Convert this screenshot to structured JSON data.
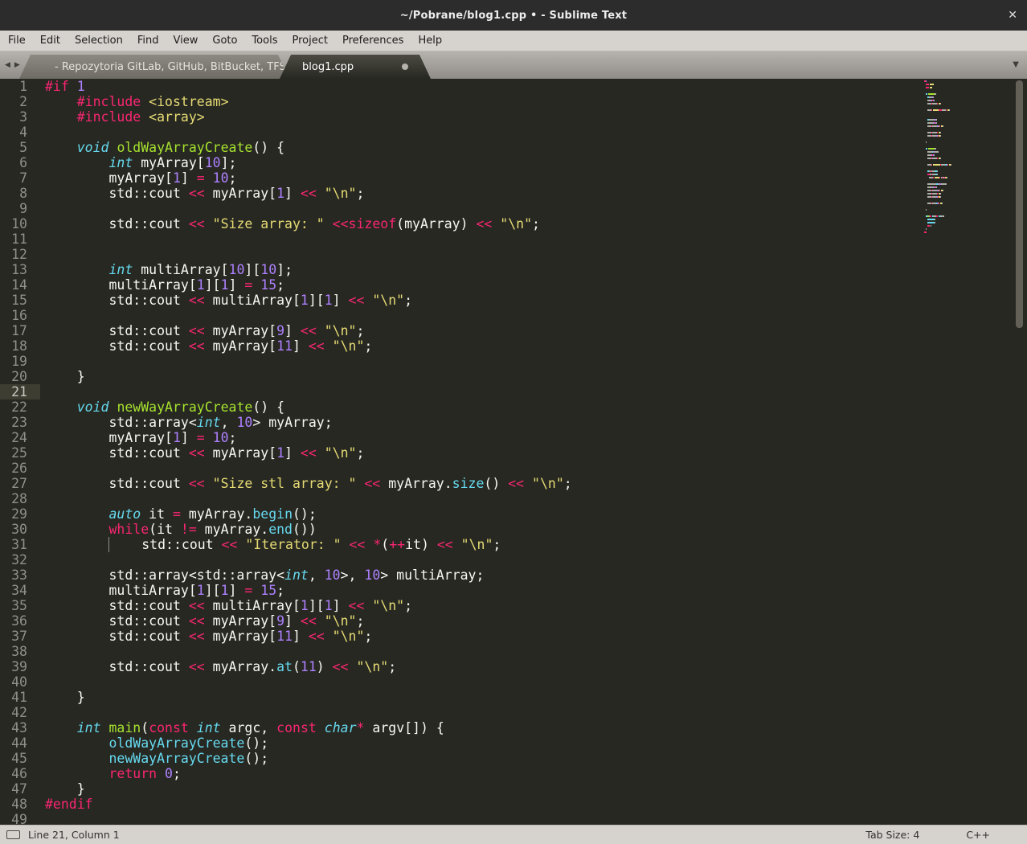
{
  "window": {
    "title": "~/Pobrane/blog1.cpp • - Sublime Text"
  },
  "icons": {
    "close": "✕",
    "back": "◀",
    "forward": "▶",
    "overflow": "▼"
  },
  "menu": {
    "items": [
      "File",
      "Edit",
      "Selection",
      "Find",
      "View",
      "Goto",
      "Tools",
      "Project",
      "Preferences",
      "Help"
    ]
  },
  "tabs": [
    {
      "label": "- Repozytoria GitLab, GitHub, BitBucket, TFS",
      "modified": true,
      "active": false
    },
    {
      "label": "blog1.cpp",
      "modified": true,
      "active": true
    }
  ],
  "status_bar": {
    "position": "Line 21, Column 1",
    "tab_size": "Tab Size: 4",
    "syntax": "C++"
  },
  "editor": {
    "current_line": 21,
    "total_lines": 49,
    "colors": {
      "background": "#272822",
      "foreground": "#f8f8f2",
      "keyword": "#f92672",
      "type": "#66d9ef",
      "call": "#66d9ef",
      "function": "#a6e22e",
      "string": "#e6db74",
      "number": "#ae81ff",
      "gutter": "#8f908a",
      "line_highlight": "#3e3d32"
    },
    "token_classes": {
      "k": "keyword",
      "t": "type-italic",
      "c": "function-call",
      "f": "function-definition",
      "s": "string",
      "n": "number",
      "p": "plain",
      "g": "indent-guide"
    },
    "lines": [
      {
        "i": 0,
        "t": [
          [
            "k",
            "#if"
          ],
          [
            "p",
            " "
          ],
          [
            "n",
            "1"
          ]
        ]
      },
      {
        "i": 4,
        "t": [
          [
            "k",
            "#include"
          ],
          [
            "p",
            " "
          ],
          [
            "s",
            "<iostream>"
          ]
        ]
      },
      {
        "i": 4,
        "t": [
          [
            "k",
            "#include"
          ],
          [
            "p",
            " "
          ],
          [
            "s",
            "<array>"
          ]
        ]
      },
      {
        "i": 0,
        "t": []
      },
      {
        "i": 4,
        "t": [
          [
            "t",
            "void"
          ],
          [
            "p",
            " "
          ],
          [
            "f",
            "oldWayArrayCreate"
          ],
          [
            "p",
            "() {"
          ]
        ]
      },
      {
        "i": 8,
        "t": [
          [
            "t",
            "int"
          ],
          [
            "p",
            " myArray["
          ],
          [
            "n",
            "10"
          ],
          [
            "p",
            "];"
          ]
        ]
      },
      {
        "i": 8,
        "t": [
          [
            "p",
            "myArray["
          ],
          [
            "n",
            "1"
          ],
          [
            "p",
            "] "
          ],
          [
            "k",
            "="
          ],
          [
            "p",
            " "
          ],
          [
            "n",
            "10"
          ],
          [
            "p",
            ";"
          ]
        ]
      },
      {
        "i": 8,
        "t": [
          [
            "p",
            "std::cout "
          ],
          [
            "k",
            "<<"
          ],
          [
            "p",
            " myArray["
          ],
          [
            "n",
            "1"
          ],
          [
            "p",
            "] "
          ],
          [
            "k",
            "<<"
          ],
          [
            "p",
            " "
          ],
          [
            "s",
            "\"\\n\""
          ],
          [
            "p",
            ";"
          ]
        ]
      },
      {
        "i": 0,
        "t": []
      },
      {
        "i": 8,
        "t": [
          [
            "p",
            "std::cout "
          ],
          [
            "k",
            "<<"
          ],
          [
            "p",
            " "
          ],
          [
            "s",
            "\"Size array: \""
          ],
          [
            "p",
            " "
          ],
          [
            "k",
            "<<sizeof"
          ],
          [
            "p",
            "(myArray) "
          ],
          [
            "k",
            "<<"
          ],
          [
            "p",
            " "
          ],
          [
            "s",
            "\"\\n\""
          ],
          [
            "p",
            ";"
          ]
        ]
      },
      {
        "i": 0,
        "t": []
      },
      {
        "i": 0,
        "t": []
      },
      {
        "i": 8,
        "t": [
          [
            "t",
            "int"
          ],
          [
            "p",
            " multiArray["
          ],
          [
            "n",
            "10"
          ],
          [
            "p",
            "]["
          ],
          [
            "n",
            "10"
          ],
          [
            "p",
            "];"
          ]
        ]
      },
      {
        "i": 8,
        "t": [
          [
            "p",
            "multiArray["
          ],
          [
            "n",
            "1"
          ],
          [
            "p",
            "]["
          ],
          [
            "n",
            "1"
          ],
          [
            "p",
            "] "
          ],
          [
            "k",
            "="
          ],
          [
            "p",
            " "
          ],
          [
            "n",
            "15"
          ],
          [
            "p",
            ";"
          ]
        ]
      },
      {
        "i": 8,
        "t": [
          [
            "p",
            "std::cout "
          ],
          [
            "k",
            "<<"
          ],
          [
            "p",
            " multiArray["
          ],
          [
            "n",
            "1"
          ],
          [
            "p",
            "]["
          ],
          [
            "n",
            "1"
          ],
          [
            "p",
            "] "
          ],
          [
            "k",
            "<<"
          ],
          [
            "p",
            " "
          ],
          [
            "s",
            "\"\\n\""
          ],
          [
            "p",
            ";"
          ]
        ]
      },
      {
        "i": 0,
        "t": []
      },
      {
        "i": 8,
        "t": [
          [
            "p",
            "std::cout "
          ],
          [
            "k",
            "<<"
          ],
          [
            "p",
            " myArray["
          ],
          [
            "n",
            "9"
          ],
          [
            "p",
            "] "
          ],
          [
            "k",
            "<<"
          ],
          [
            "p",
            " "
          ],
          [
            "s",
            "\"\\n\""
          ],
          [
            "p",
            ";"
          ]
        ]
      },
      {
        "i": 8,
        "t": [
          [
            "p",
            "std::cout "
          ],
          [
            "k",
            "<<"
          ],
          [
            "p",
            " myArray["
          ],
          [
            "n",
            "11"
          ],
          [
            "p",
            "] "
          ],
          [
            "k",
            "<<"
          ],
          [
            "p",
            " "
          ],
          [
            "s",
            "\"\\n\""
          ],
          [
            "p",
            ";"
          ]
        ]
      },
      {
        "i": 0,
        "t": []
      },
      {
        "i": 4,
        "t": [
          [
            "p",
            "}"
          ]
        ]
      },
      {
        "i": 0,
        "t": []
      },
      {
        "i": 4,
        "t": [
          [
            "t",
            "void"
          ],
          [
            "p",
            " "
          ],
          [
            "f",
            "newWayArrayCreate"
          ],
          [
            "p",
            "() {"
          ]
        ]
      },
      {
        "i": 8,
        "t": [
          [
            "p",
            "std::array<"
          ],
          [
            "t",
            "int"
          ],
          [
            "p",
            ", "
          ],
          [
            "n",
            "10"
          ],
          [
            "p",
            "> myArray;"
          ]
        ]
      },
      {
        "i": 8,
        "t": [
          [
            "p",
            "myArray["
          ],
          [
            "n",
            "1"
          ],
          [
            "p",
            "] "
          ],
          [
            "k",
            "="
          ],
          [
            "p",
            " "
          ],
          [
            "n",
            "10"
          ],
          [
            "p",
            ";"
          ]
        ]
      },
      {
        "i": 8,
        "t": [
          [
            "p",
            "std::cout "
          ],
          [
            "k",
            "<<"
          ],
          [
            "p",
            " myArray["
          ],
          [
            "n",
            "1"
          ],
          [
            "p",
            "] "
          ],
          [
            "k",
            "<<"
          ],
          [
            "p",
            " "
          ],
          [
            "s",
            "\"\\n\""
          ],
          [
            "p",
            ";"
          ]
        ]
      },
      {
        "i": 0,
        "t": []
      },
      {
        "i": 8,
        "t": [
          [
            "p",
            "std::cout "
          ],
          [
            "k",
            "<<"
          ],
          [
            "p",
            " "
          ],
          [
            "s",
            "\"Size stl array: \""
          ],
          [
            "p",
            " "
          ],
          [
            "k",
            "<<"
          ],
          [
            "p",
            " myArray."
          ],
          [
            "c",
            "size"
          ],
          [
            "p",
            "() "
          ],
          [
            "k",
            "<<"
          ],
          [
            "p",
            " "
          ],
          [
            "s",
            "\"\\n\""
          ],
          [
            "p",
            ";"
          ]
        ]
      },
      {
        "i": 0,
        "t": []
      },
      {
        "i": 8,
        "t": [
          [
            "t",
            "auto"
          ],
          [
            "p",
            " it "
          ],
          [
            "k",
            "="
          ],
          [
            "p",
            " myArray."
          ],
          [
            "c",
            "begin"
          ],
          [
            "p",
            "();"
          ]
        ]
      },
      {
        "i": 8,
        "t": [
          [
            "k",
            "while"
          ],
          [
            "p",
            "(it "
          ],
          [
            "k",
            "!="
          ],
          [
            "p",
            " myArray."
          ],
          [
            "c",
            "end"
          ],
          [
            "p",
            "())"
          ]
        ]
      },
      {
        "i": 8,
        "t": [
          [
            "g",
            "    "
          ],
          [
            "p",
            "std::cout "
          ],
          [
            "k",
            "<<"
          ],
          [
            "p",
            " "
          ],
          [
            "s",
            "\"Iterator: \""
          ],
          [
            "p",
            " "
          ],
          [
            "k",
            "<<"
          ],
          [
            "p",
            " "
          ],
          [
            "k",
            "*"
          ],
          [
            "p",
            "("
          ],
          [
            "k",
            "++"
          ],
          [
            "p",
            "it) "
          ],
          [
            "k",
            "<<"
          ],
          [
            "p",
            " "
          ],
          [
            "s",
            "\"\\n\""
          ],
          [
            "p",
            ";"
          ]
        ]
      },
      {
        "i": 0,
        "t": []
      },
      {
        "i": 8,
        "t": [
          [
            "p",
            "std::array<std::array<"
          ],
          [
            "t",
            "int"
          ],
          [
            "p",
            ", "
          ],
          [
            "n",
            "10"
          ],
          [
            "p",
            ">, "
          ],
          [
            "n",
            "10"
          ],
          [
            "p",
            "> multiArray;"
          ]
        ]
      },
      {
        "i": 8,
        "t": [
          [
            "p",
            "multiArray["
          ],
          [
            "n",
            "1"
          ],
          [
            "p",
            "]["
          ],
          [
            "n",
            "1"
          ],
          [
            "p",
            "] "
          ],
          [
            "k",
            "="
          ],
          [
            "p",
            " "
          ],
          [
            "n",
            "15"
          ],
          [
            "p",
            ";"
          ]
        ]
      },
      {
        "i": 8,
        "t": [
          [
            "p",
            "std::cout "
          ],
          [
            "k",
            "<<"
          ],
          [
            "p",
            " multiArray["
          ],
          [
            "n",
            "1"
          ],
          [
            "p",
            "]["
          ],
          [
            "n",
            "1"
          ],
          [
            "p",
            "] "
          ],
          [
            "k",
            "<<"
          ],
          [
            "p",
            " "
          ],
          [
            "s",
            "\"\\n\""
          ],
          [
            "p",
            ";"
          ]
        ]
      },
      {
        "i": 8,
        "t": [
          [
            "p",
            "std::cout "
          ],
          [
            "k",
            "<<"
          ],
          [
            "p",
            " myArray["
          ],
          [
            "n",
            "9"
          ],
          [
            "p",
            "] "
          ],
          [
            "k",
            "<<"
          ],
          [
            "p",
            " "
          ],
          [
            "s",
            "\"\\n\""
          ],
          [
            "p",
            ";"
          ]
        ]
      },
      {
        "i": 8,
        "t": [
          [
            "p",
            "std::cout "
          ],
          [
            "k",
            "<<"
          ],
          [
            "p",
            " myArray["
          ],
          [
            "n",
            "11"
          ],
          [
            "p",
            "] "
          ],
          [
            "k",
            "<<"
          ],
          [
            "p",
            " "
          ],
          [
            "s",
            "\"\\n\""
          ],
          [
            "p",
            ";"
          ]
        ]
      },
      {
        "i": 0,
        "t": []
      },
      {
        "i": 8,
        "t": [
          [
            "p",
            "std::cout "
          ],
          [
            "k",
            "<<"
          ],
          [
            "p",
            " myArray."
          ],
          [
            "c",
            "at"
          ],
          [
            "p",
            "("
          ],
          [
            "n",
            "11"
          ],
          [
            "p",
            ") "
          ],
          [
            "k",
            "<<"
          ],
          [
            "p",
            " "
          ],
          [
            "s",
            "\"\\n\""
          ],
          [
            "p",
            ";"
          ]
        ]
      },
      {
        "i": 0,
        "t": []
      },
      {
        "i": 4,
        "t": [
          [
            "p",
            "}"
          ]
        ]
      },
      {
        "i": 0,
        "t": []
      },
      {
        "i": 4,
        "t": [
          [
            "t",
            "int"
          ],
          [
            "p",
            " "
          ],
          [
            "f",
            "main"
          ],
          [
            "p",
            "("
          ],
          [
            "k",
            "const"
          ],
          [
            "p",
            " "
          ],
          [
            "t",
            "int"
          ],
          [
            "p",
            " argc, "
          ],
          [
            "k",
            "const"
          ],
          [
            "p",
            " "
          ],
          [
            "t",
            "char"
          ],
          [
            "k",
            "*"
          ],
          [
            "p",
            " argv[]) {"
          ]
        ]
      },
      {
        "i": 8,
        "t": [
          [
            "c",
            "oldWayArrayCreate"
          ],
          [
            "p",
            "();"
          ]
        ]
      },
      {
        "i": 8,
        "t": [
          [
            "c",
            "newWayArrayCreate"
          ],
          [
            "p",
            "();"
          ]
        ]
      },
      {
        "i": 8,
        "t": [
          [
            "k",
            "return"
          ],
          [
            "p",
            " "
          ],
          [
            "n",
            "0"
          ],
          [
            "p",
            ";"
          ]
        ]
      },
      {
        "i": 4,
        "t": [
          [
            "p",
            "}"
          ]
        ]
      },
      {
        "i": 0,
        "t": [
          [
            "k",
            "#endif"
          ]
        ]
      },
      {
        "i": 0,
        "t": []
      }
    ]
  }
}
